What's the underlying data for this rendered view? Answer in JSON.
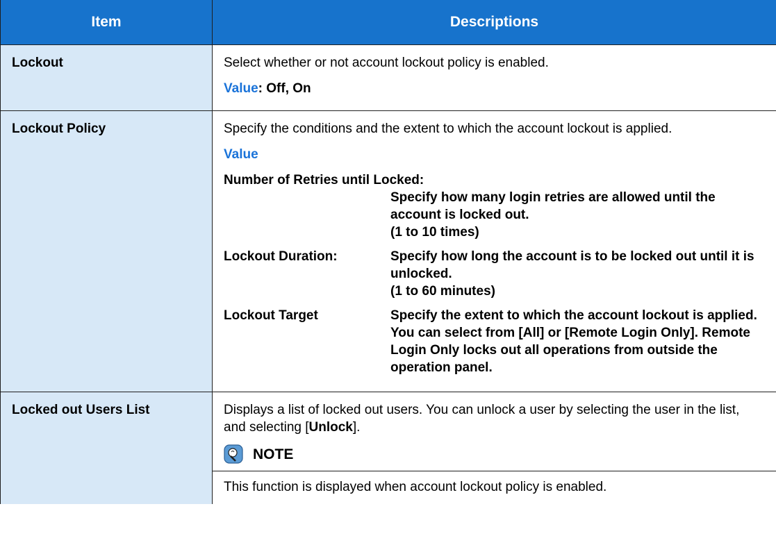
{
  "table": {
    "headers": {
      "item": "Item",
      "descriptions": "Descriptions"
    },
    "rows": [
      {
        "item": "Lockout",
        "text": "Select whether or not account lockout policy is enabled.",
        "value_label": "Value",
        "value_text": ": Off, On"
      },
      {
        "item": "Lockout Policy",
        "text": "Specify the conditions and the extent to which the account lockout is applied.",
        "value_label": "Value",
        "settings": [
          {
            "name": "Number of Retries until Locked:",
            "description": "Specify how many login retries are allowed until the account is locked out.",
            "range": "(1 to 10 times)"
          },
          {
            "name": "Lockout Duration:",
            "description": "Specify how long the account is to be locked out until it is unlocked.",
            "range": "(1 to 60 minutes)"
          },
          {
            "name": "Lockout Target",
            "description": "Specify the extent to which the account lockout is applied. You can select from [All] or [Remote Login Only]. Remote Login Only locks out all operations from outside the operation panel."
          }
        ]
      },
      {
        "item": "Locked out Users List",
        "text_before": "Displays a list of locked out users. You can unlock a user by selecting the user in the list, and selecting [",
        "unlock_label": "Unlock",
        "text_after": "].",
        "note": {
          "icon": "note-lightbulb-icon",
          "title": "NOTE",
          "text": "This function is displayed when account lockout policy is enabled."
        }
      }
    ]
  },
  "colors": {
    "header_background": "#1773cc",
    "item_column_background": "#d7e8f7",
    "value_label": "#1a73d9"
  }
}
